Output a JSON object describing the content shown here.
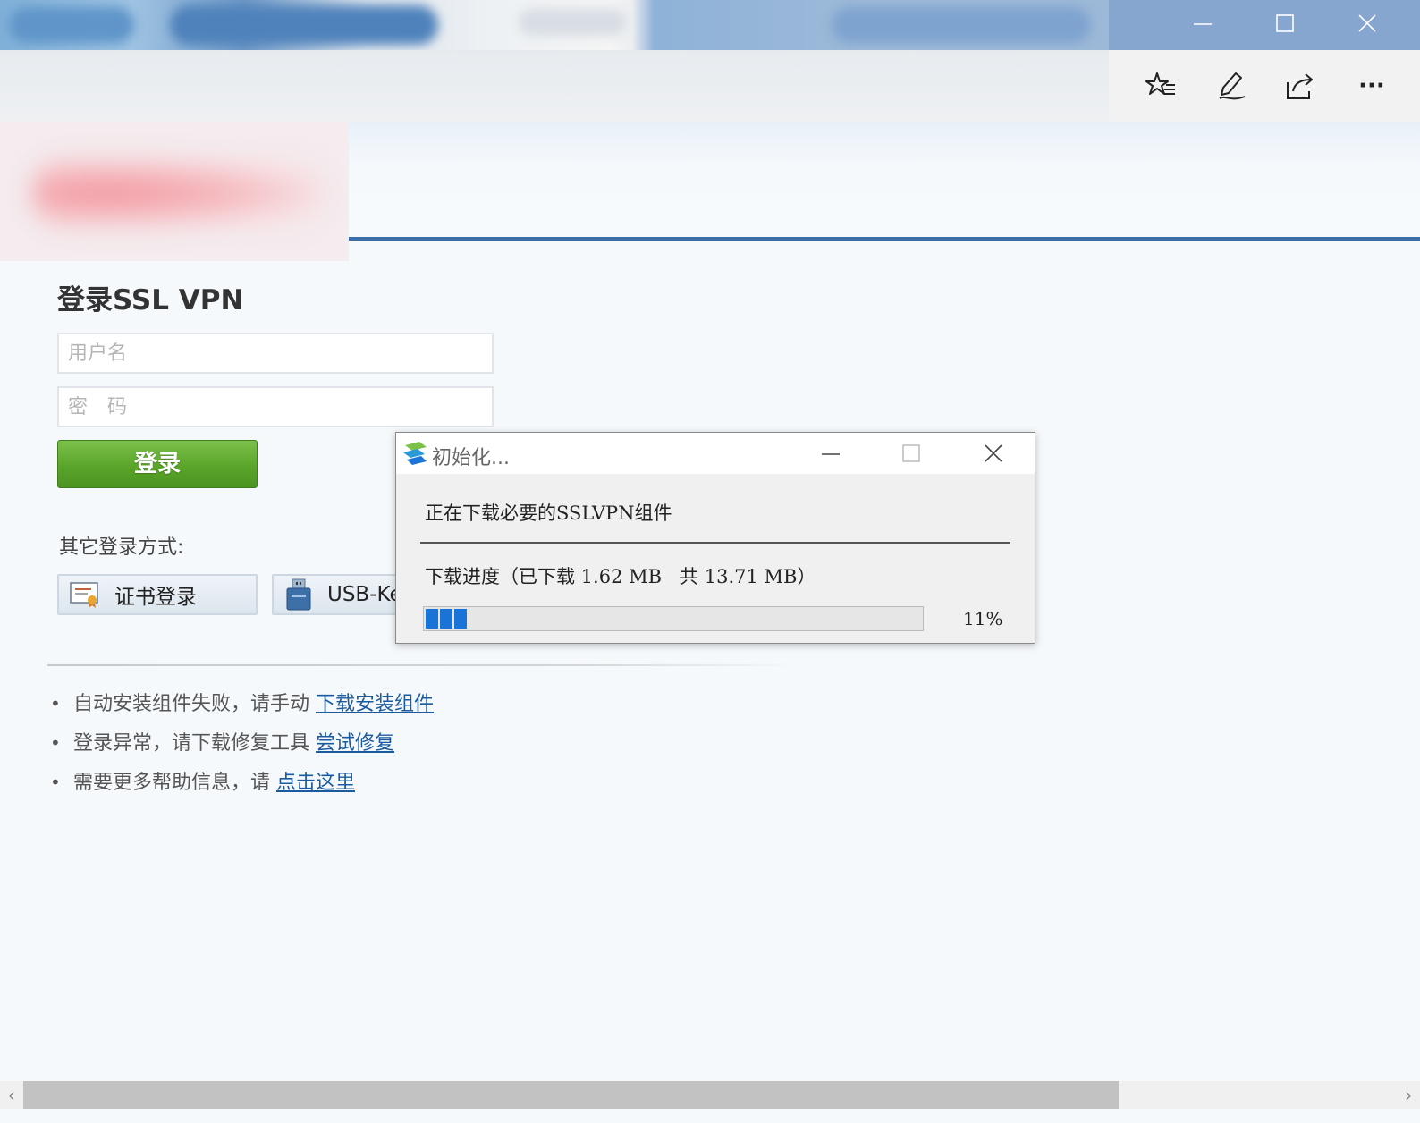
{
  "browser": {
    "window_controls": {
      "minimize": "minimize",
      "maximize": "maximize",
      "close": "close"
    },
    "toolbar_icons": [
      "favorites-star-icon",
      "pen-icon",
      "share-icon",
      "more-icon"
    ],
    "more_label": "···"
  },
  "login": {
    "title": "登录SSL VPN",
    "username_placeholder": "用户名",
    "password_placeholder": "密　码",
    "submit_label": "登录",
    "other_methods_label": "其它登录方式:",
    "cert_login_label": "证书登录",
    "usbkey_login_label": "USB-Ke"
  },
  "help": {
    "items": [
      {
        "text": "自动安装组件失败，请手动 ",
        "link": "下载安装组件"
      },
      {
        "text": "登录异常，请下载修复工具 ",
        "link": "尝试修复"
      },
      {
        "text": "需要更多帮助信息，请 ",
        "link": "点击这里"
      }
    ]
  },
  "dialog": {
    "title": "初始化...",
    "message": "正在下载必要的SSLVPN组件",
    "progress_text": "下载进度（已下载 1.62 MB   共 13.71 MB）",
    "progress_percent_label": "11%",
    "progress_fraction": 0.11,
    "progress_accent": "#1a74d8"
  },
  "colors": {
    "header_line": "#3c6ea8",
    "login_button": "#5aa52a",
    "link": "#1a5a9e"
  }
}
